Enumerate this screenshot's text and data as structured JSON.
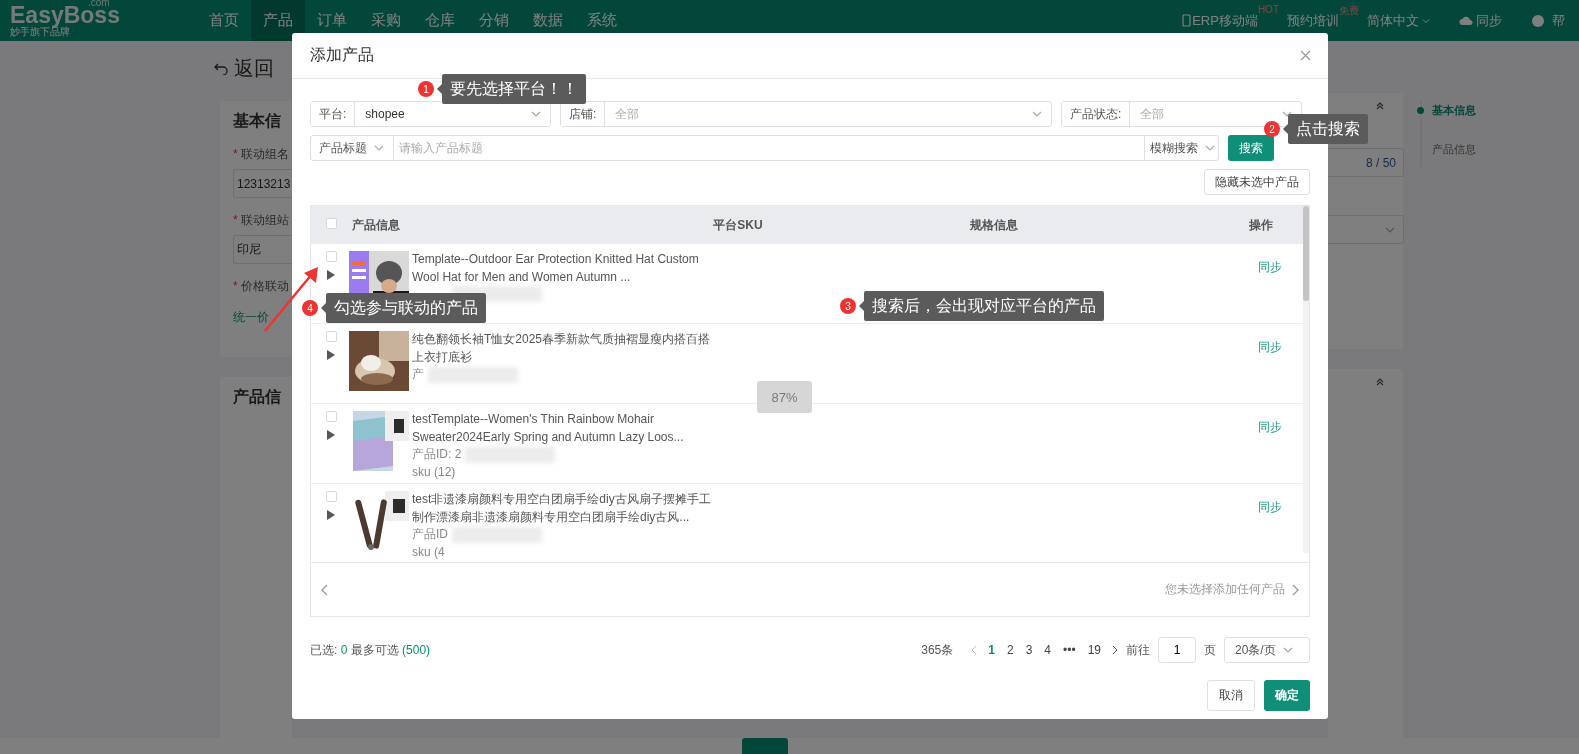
{
  "nav": {
    "logo": "EasyBoss",
    "logo_suffix": ".com",
    "tagline": "妙手旗下品牌",
    "menu": [
      {
        "label": "首页",
        "selected": false
      },
      {
        "label": "产品",
        "selected": true
      },
      {
        "label": "订单",
        "selected": false
      },
      {
        "label": "采购",
        "selected": false
      },
      {
        "label": "仓库",
        "selected": false
      },
      {
        "label": "分销",
        "selected": false
      },
      {
        "label": "数据",
        "selected": false
      },
      {
        "label": "系统",
        "selected": false
      }
    ],
    "mobile": "ERP移动端",
    "mobile_badge": "HOT",
    "training": "预约培训",
    "training_badge": "免费",
    "language": "简体中文",
    "sync": "同步",
    "help": "帮"
  },
  "page": {
    "required_mark": "*",
    "back": "返回",
    "card_title": "基本信",
    "name_label": "联动组名",
    "name_value": "12313213",
    "name_counter": "8 / 50",
    "site_label": "联动组站",
    "site_value": "印尼",
    "price_label": "价格联动",
    "price_option": "统一价",
    "card2_title": "产品信",
    "anchors": [
      {
        "label": "基本信息",
        "selected": true
      },
      {
        "label": "产品信息",
        "selected": false
      }
    ]
  },
  "modal": {
    "title": "添加产品",
    "filters": [
      {
        "label": "平台:",
        "value": "shopee"
      },
      {
        "label": "店铺:",
        "placeholder": "全部"
      },
      {
        "label": "产品状态:",
        "placeholder": "全部"
      }
    ],
    "search_field": "产品标题",
    "search_placeholder": "请输入产品标题",
    "search_mode": "模糊搜索",
    "search_button": "搜索",
    "hide_button": "隐藏未选中产品",
    "table": {
      "columns": [
        "产品信息",
        "平台SKU",
        "规格信息",
        "操作"
      ],
      "all_checked": false,
      "rows": [
        {
          "checked": false,
          "title": "Template--Outdoor Ear Protection Knitted Hat Custom Wool Hat for Men and Women Autumn ...",
          "action": "同步"
        },
        {
          "checked": false,
          "title": "纯色翻领长袖T恤女2025春季新款气质抽褶显瘦内搭百搭上衣打底衫",
          "id": "产",
          "action": "同步"
        },
        {
          "checked": false,
          "title": "testTemplate--Women's Thin Rainbow Mohair Sweater2024Early Spring and Autumn Lazy Loos...",
          "id": "产品ID: 2",
          "sku": "sku (12)",
          "action": "同步"
        },
        {
          "checked": false,
          "title": "test非遗漆扇颜料专用空白团扇手绘diy古风扇子摆摊手工制作漂漆扇非遗漆扇颜料专用空白团扇手绘diy古风...",
          "id": "产品ID",
          "sku": "sku (4",
          "action": "同步"
        }
      ]
    },
    "selected_note": "您未选择添加任何产品",
    "summary": {
      "selected_label": "已选:",
      "selected_count": "0",
      "max_label": "最多可选",
      "max_count": "(500)"
    },
    "pagination": {
      "total": "365条",
      "pages": [
        {
          "label": "1",
          "selected": true
        },
        {
          "label": "2",
          "selected": false
        },
        {
          "label": "3",
          "selected": false
        },
        {
          "label": "4",
          "selected": false
        },
        {
          "label": "•••",
          "selected": false
        },
        {
          "label": "19",
          "selected": false
        }
      ],
      "goto": "前往",
      "goto_value": "1",
      "page_unit": "页",
      "page_size": "20条/页"
    },
    "cancel": "取消",
    "confirm": "确定"
  },
  "zoom_toast": "87%",
  "annotations": [
    {
      "number": "1",
      "text": "要先选择平台！！"
    },
    {
      "number": "2",
      "text": "点击搜索"
    },
    {
      "number": "4",
      "text": "勾选参与联动的产品"
    },
    {
      "number": "3",
      "text": "搜索后，会出现对应平台的产品"
    }
  ]
}
